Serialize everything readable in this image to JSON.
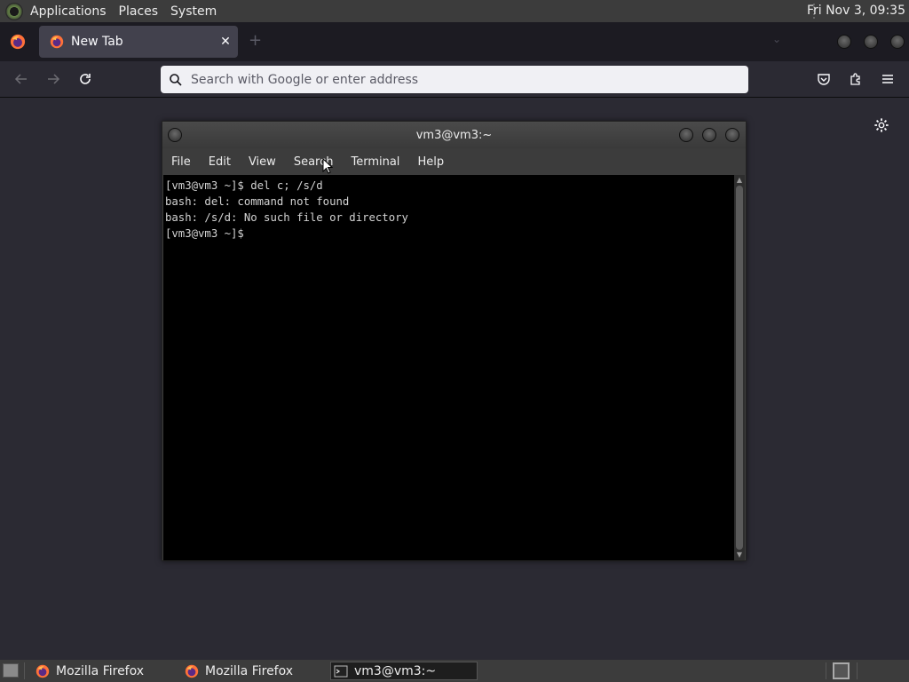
{
  "top_panel": {
    "menus": [
      "Applications",
      "Places",
      "System"
    ],
    "clock": "Fri Nov  3, 09:35"
  },
  "browser": {
    "tab": {
      "label": "New Tab",
      "close": "✕"
    },
    "new_tab": "+",
    "urlbar": {
      "placeholder": "Search with Google or enter address"
    }
  },
  "terminal": {
    "title": "vm3@vm3:~",
    "menus": [
      "File",
      "Edit",
      "View",
      "Search",
      "Terminal",
      "Help"
    ],
    "lines": [
      "[vm3@vm3 ~]$ del c; /s/d",
      "bash: del: command not found",
      "bash: /s/d: No such file or directory",
      "[vm3@vm3 ~]$"
    ]
  },
  "taskbar": {
    "tasks": [
      {
        "label": "Mozilla Firefox",
        "icon": "firefox-icon",
        "active": false
      },
      {
        "label": "Mozilla Firefox",
        "icon": "firefox-icon",
        "active": false
      },
      {
        "label": "vm3@vm3:~",
        "icon": "terminal-icon",
        "active": true
      }
    ]
  },
  "colors": {
    "panel": "#3c3c3c",
    "browser_bg": "#2b2a33",
    "tabstrip": "#1c1b22",
    "terminal_bg": "#000000",
    "terminal_fg": "#d3d3d3"
  }
}
